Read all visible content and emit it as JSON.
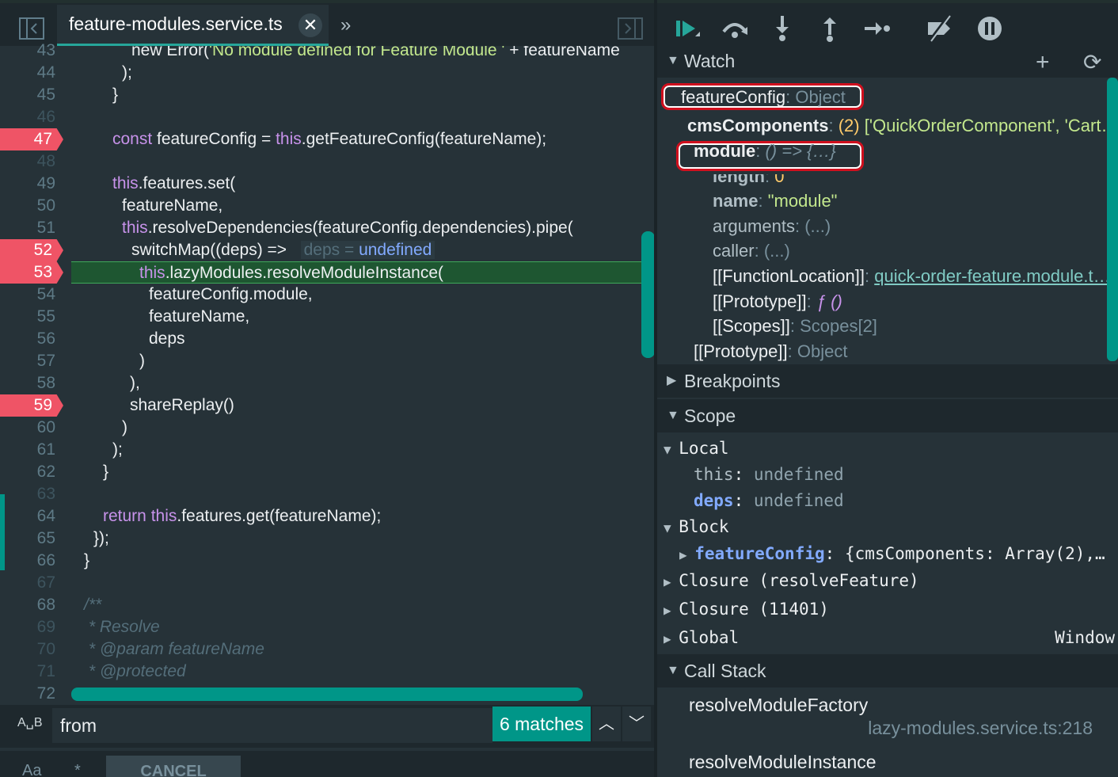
{
  "editor": {
    "tab_title": "feature-modules.service.ts",
    "tab_close": "✕",
    "more": "»",
    "gutter": [
      {
        "n": "43",
        "bp": false,
        "dim": false
      },
      {
        "n": "44",
        "bp": false,
        "dim": false
      },
      {
        "n": "45",
        "bp": false,
        "dim": false
      },
      {
        "n": "46",
        "bp": false,
        "dim": true
      },
      {
        "n": "47",
        "bp": true,
        "dim": false
      },
      {
        "n": "48",
        "bp": false,
        "dim": true
      },
      {
        "n": "49",
        "bp": false,
        "dim": false
      },
      {
        "n": "50",
        "bp": false,
        "dim": false
      },
      {
        "n": "51",
        "bp": false,
        "dim": false
      },
      {
        "n": "52",
        "bp": true,
        "dim": false
      },
      {
        "n": "53",
        "bp": true,
        "dim": false
      },
      {
        "n": "54",
        "bp": false,
        "dim": false
      },
      {
        "n": "55",
        "bp": false,
        "dim": false
      },
      {
        "n": "56",
        "bp": false,
        "dim": false
      },
      {
        "n": "57",
        "bp": false,
        "dim": false
      },
      {
        "n": "58",
        "bp": false,
        "dim": false
      },
      {
        "n": "59",
        "bp": true,
        "dim": false
      },
      {
        "n": "60",
        "bp": false,
        "dim": false
      },
      {
        "n": "61",
        "bp": false,
        "dim": false
      },
      {
        "n": "62",
        "bp": false,
        "dim": false
      },
      {
        "n": "63",
        "bp": false,
        "dim": true
      },
      {
        "n": "64",
        "bp": false,
        "dim": false
      },
      {
        "n": "65",
        "bp": false,
        "dim": false
      },
      {
        "n": "66",
        "bp": false,
        "dim": false
      },
      {
        "n": "67",
        "bp": false,
        "dim": true
      },
      {
        "n": "68",
        "bp": false,
        "dim": false
      },
      {
        "n": "69",
        "bp": false,
        "dim": true
      },
      {
        "n": "70",
        "bp": false,
        "dim": true
      },
      {
        "n": "71",
        "bp": false,
        "dim": true
      },
      {
        "n": "72",
        "bp": false,
        "dim": false
      }
    ],
    "lines": {
      "l43_a": "new Error(",
      "l43_b": "'No module defined for Feature Module '",
      "l43_c": " + featureName",
      "l44": ");",
      "l45": "}",
      "l47_a": "const",
      "l47_b": " featureConfig = ",
      "l47_c": "this",
      "l47_d": ".getFeatureConfig(featureName);",
      "l49_a": "this",
      "l49_b": ".features.set(",
      "l50": "featureName,",
      "l51_a": "this",
      "l51_b": ".resolveDependencies(featureConfig.dependencies).pipe(",
      "l52_a": "switchMap((deps) =>",
      "l52_inl_a": "deps = ",
      "l52_inl_b": "undefined",
      "l53_a": "this",
      "l53_b": ".lazyModules.resolveModuleInstance(",
      "l54": "featureConfig.module,",
      "l55": "featureName,",
      "l56": "deps",
      "l57": ")",
      "l58": "),",
      "l59": "shareReplay()",
      "l60": ")",
      "l61": ");",
      "l62": "}",
      "l64_a": "return",
      "l64_b": " this",
      "l64_c": ".features.get(featureName);",
      "l65": "});",
      "l66": "}",
      "l68": "/**",
      "l69": " * Resolve",
      "l70": " * @param featureName",
      "l71": " * @protected"
    },
    "find": {
      "case_icon": "A␣B",
      "value": "from",
      "matches": "6 matches",
      "prev": "︿",
      "next": "﹀"
    },
    "bottom": {
      "aa": "Aa",
      "star": "*",
      "cancel": "CANCEL"
    }
  },
  "debugger": {
    "toolbar_icons": [
      "resume-icon",
      "step-over-icon",
      "step-into-icon",
      "step-out-icon",
      "step-icon",
      "deactivate-breakpoints-icon",
      "pause-on-exceptions-icon"
    ],
    "watch": {
      "title": "Watch",
      "add": "+",
      "refresh": "⟳",
      "feature_config_key": "featureConfig",
      "feature_config_val": "Object",
      "cms_key": "cmsComponents",
      "cms_count": "(2)",
      "cms_val": "['QuickOrderComponent', 'Cart…",
      "module_key": "module",
      "module_val": "() => {…}",
      "length_key": "length",
      "length_val": "0",
      "name_key": "name",
      "name_val": "\"module\"",
      "arguments_key": "arguments",
      "arguments_val": "(...)",
      "caller_key": "caller",
      "caller_val": "(...)",
      "fnloc_key": "[[FunctionLocation]]",
      "fnloc_val": "quick-order-feature.module.t…",
      "proto1_key": "[[Prototype]]",
      "proto1_val": "ƒ ()",
      "scopes_key": "[[Scopes]]",
      "scopes_val": "Scopes[2]",
      "proto2_key": "[[Prototype]]",
      "proto2_val": "Object",
      "sep": ": "
    },
    "breakpoints": {
      "title": "Breakpoints"
    },
    "scope": {
      "title": "Scope",
      "local": "Local",
      "this_key": "this",
      "this_val": "undefined",
      "deps_key": "deps",
      "deps_val": "undefined",
      "block": "Block",
      "fc_key": "featureConfig",
      "fc_val": "{cmsComponents: Array(2),…",
      "closure1": "Closure (resolveFeature)",
      "closure2": "Closure (11401)",
      "global": "Global",
      "global_val": "Window",
      "colon": ": "
    },
    "callstack": {
      "title": "Call Stack",
      "frames": [
        {
          "fn": "resolveModuleFactory",
          "loc": "lazy-modules.service.ts:218"
        },
        {
          "fn": "resolveModuleInstance",
          "loc": ""
        }
      ]
    }
  }
}
